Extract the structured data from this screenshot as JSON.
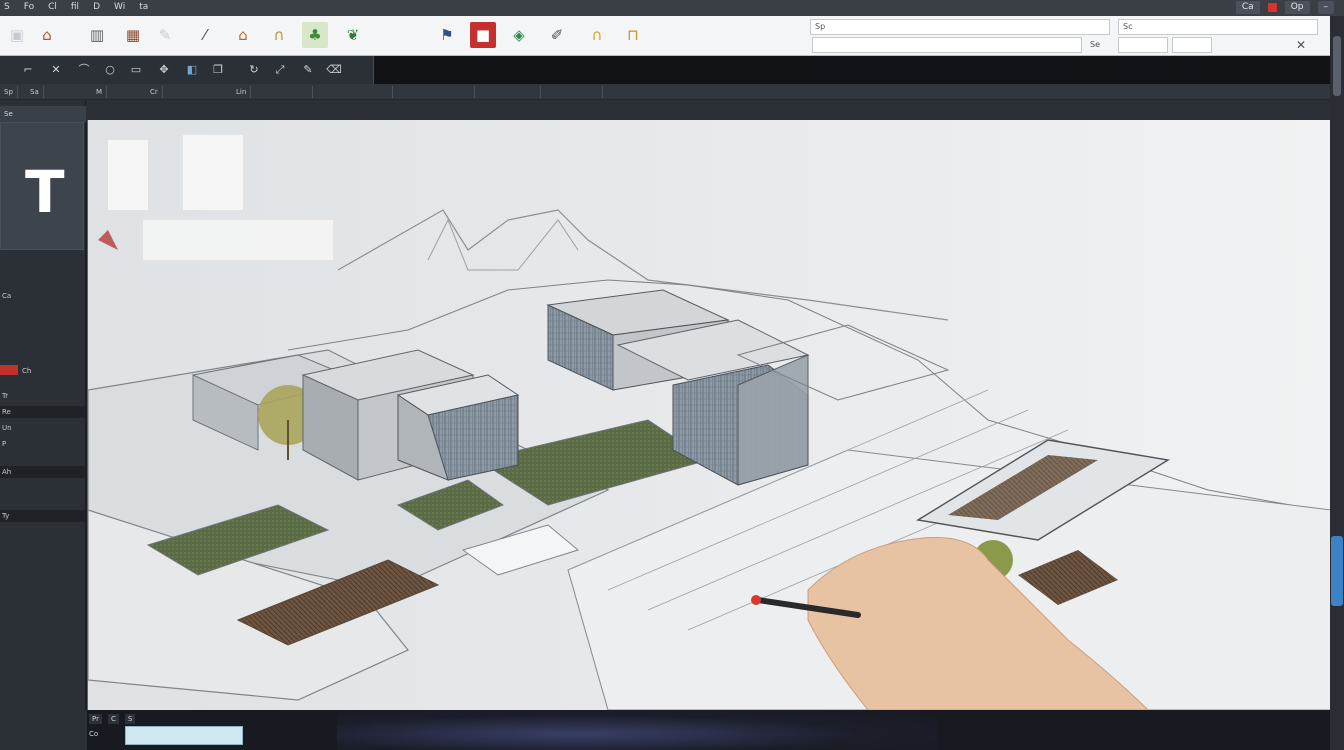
{
  "app": {
    "top_menu": [
      "S",
      "Fo",
      "Cl",
      "fil",
      "D",
      "Wi",
      "ta"
    ],
    "tray": [
      "Ca",
      "Op"
    ]
  },
  "ribbon": {
    "tools": [
      {
        "icon": "drawing-board-icon",
        "color": "#3a3f46"
      },
      {
        "icon": "house-icon",
        "color": "#b4522a"
      },
      {
        "icon": "tower-icon",
        "color": "#5a5f66"
      },
      {
        "icon": "building-icon",
        "color": "#8b4a2b"
      },
      {
        "icon": "pencil-icon",
        "color": "#4a4e55"
      },
      {
        "icon": "roof-icon",
        "color": "#b8672e"
      },
      {
        "icon": "arch-icon",
        "color": "#c3902a"
      },
      {
        "icon": "tree-icon",
        "color": "#3f8a3c"
      },
      {
        "icon": "leaf-icon",
        "color": "#2e7a36"
      },
      {
        "icon": "flag-icon",
        "color": "#2f4e8c"
      },
      {
        "icon": "stop-icon",
        "color": "#c4302b"
      },
      {
        "icon": "cube-icon",
        "color": "#2d8a4e"
      },
      {
        "icon": "pen-tool-icon",
        "color": "#4a4e55"
      },
      {
        "icon": "arch-gold-icon",
        "color": "#d6a62c"
      }
    ],
    "search_value": "Sp",
    "secondary_value": "",
    "label_a": "Se",
    "label_b": "Sc"
  },
  "toolbar3": [
    "Sp",
    "Sa",
    "M",
    "Cr",
    "Lin"
  ],
  "left_panel": {
    "header": "Se",
    "rows": [
      "Ch",
      "Ca",
      "Tr",
      "Re",
      "Un",
      "P",
      "Ah",
      "Ty"
    ]
  },
  "status": {
    "items": [
      "Pr",
      "C",
      "S"
    ],
    "command_placeholder": "",
    "prompt": "Co"
  }
}
